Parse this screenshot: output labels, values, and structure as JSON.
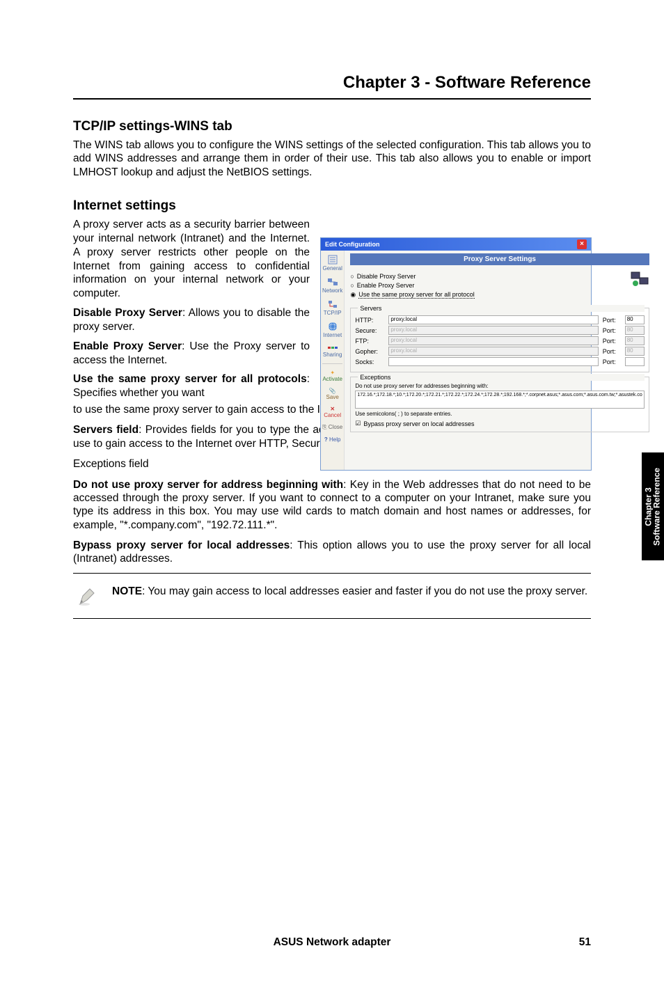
{
  "chapter_title": "Chapter 3 - Software Reference",
  "section1": {
    "title": "TCP/IP settings-WINS tab",
    "body": "The WINS tab allows you to configure the WINS settings of the selected configuration. This tab allows you to add WINS addresses and arrange them in order of their use. This tab also allows you to enable or import LMHOST lookup and adjust the NetBIOS settings."
  },
  "section2": {
    "title": "Internet settings",
    "p1": "A proxy server acts as a security barrier between your internal network (Intranet) and the Internet. A proxy server restricts other people on the Internet from gaining access to confidential information on your internal network or your computer.",
    "p2_bold": "Disable Proxy Server",
    "p2_rest": ": Allows you to disable the proxy server.",
    "p3_bold": "Enable Proxy Server",
    "p3_rest": ": Use the Proxy server to access the Internet.",
    "p4_bold": "Use the same proxy server for all protocols",
    "p4_rest": ": Specifies whether you want",
    "p4b": "to use the same proxy server to gain access to the Internet using all protocols.",
    "p5_bold": "Servers field",
    "p5_rest": ": Provides fields for you to type the address and port number of the proxy server you want to use to gain access to the Internet over HTTP, Secure, FTP, Gopher, and Socks protocol.",
    "p6": "Exceptions field",
    "p7_bold": "Do not use proxy server for address beginning with",
    "p7_rest": ": Key in the Web addresses that do not need to be accessed through the proxy server. If you want to connect to a computer on your Intranet, make sure you type its address in this box. You may use wild cards to match domain and host names or addresses, for example, \"*.company.com\", \"192.72.111.*\".",
    "p8_bold": "Bypass proxy server for local addresses",
    "p8_rest": ": This option allows you to use the proxy server for all local (Intranet) addresses."
  },
  "dialog": {
    "title": "Edit Configuration",
    "banner": "Proxy Server Settings",
    "radio1": "Disable Proxy Server",
    "radio2": "Enable Proxy Server",
    "radio3": "Use the same proxy server for all protocol",
    "servers_label": "Servers",
    "http": "HTTP:",
    "secure": "Secure:",
    "ftp": "FTP:",
    "gopher": "Gopher:",
    "socks": "Socks:",
    "port_label": "Port:",
    "http_val": "proxy.local",
    "secure_val": "proxy.local",
    "ftp_val": "proxy.local",
    "gopher_val": "proxy.local",
    "socks_val": "",
    "http_port": "80",
    "secure_port": "80",
    "ftp_port": "80",
    "gopher_port": "80",
    "socks_port": "",
    "exceptions_label": "Exceptions",
    "exceptions_sub": "Do not use proxy server for addresses beginning with:",
    "exceptions_val": "172.16.*;172.18.*;10.*;172.20.*;172.21.*;172.22.*;172.24.*;172.28.*;192.168.*;*.corpnet.asus;*.asus.com;*.asus.com.tw;*.asustek.co",
    "exceptions_note": "Use semicolons( ; ) to separate entries.",
    "bypass_chk": "Bypass proxy server on local addresses",
    "sidebar": {
      "general": "General",
      "network": "Network",
      "tcpip": "TCP/IP",
      "internet": "Internet",
      "sharing": "Sharing",
      "activate": "Activate",
      "save": "Save",
      "cancel": "Cancel",
      "close": "Close",
      "help": "Help"
    }
  },
  "note": {
    "bold": "NOTE",
    "text": ": You may gain access to local addresses easier and faster if you do not use the proxy server."
  },
  "side_tab": {
    "line1": "Chapter 3",
    "line2": "Software Reference"
  },
  "footer": {
    "title": "ASUS Network adapter",
    "page": "51"
  }
}
